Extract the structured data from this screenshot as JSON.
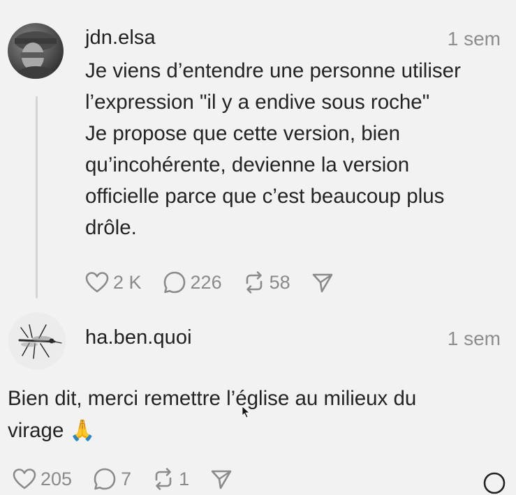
{
  "posts": [
    {
      "username": "jdn.elsa",
      "time": "1 sem",
      "lines": [
        "Je viens d’entendre une personne utiliser",
        "l’expression \"il y a endive sous roche\"",
        "Je propose que cette version, bien",
        "qu’incohérente, devienne la version",
        "officielle parce que c’est beaucoup plus",
        "drôle."
      ],
      "likes": "2 K",
      "replies": "226",
      "reposts": "58"
    },
    {
      "username": "ha.ben.quoi",
      "time": "1 sem",
      "lines": [
        "Bien dit, merci remettre l’église au milieux du",
        "virage 🙏"
      ],
      "likes": "205",
      "replies": "7",
      "reposts": "1"
    }
  ],
  "icons": {
    "like": "heart-icon",
    "reply": "comment-icon",
    "repost": "repost-icon",
    "share": "send-icon"
  },
  "colors": {
    "background": "#f2f2f2",
    "text": "#1d1d1d",
    "muted": "#8a8a8a",
    "thread_line": "#d4d4d4"
  }
}
